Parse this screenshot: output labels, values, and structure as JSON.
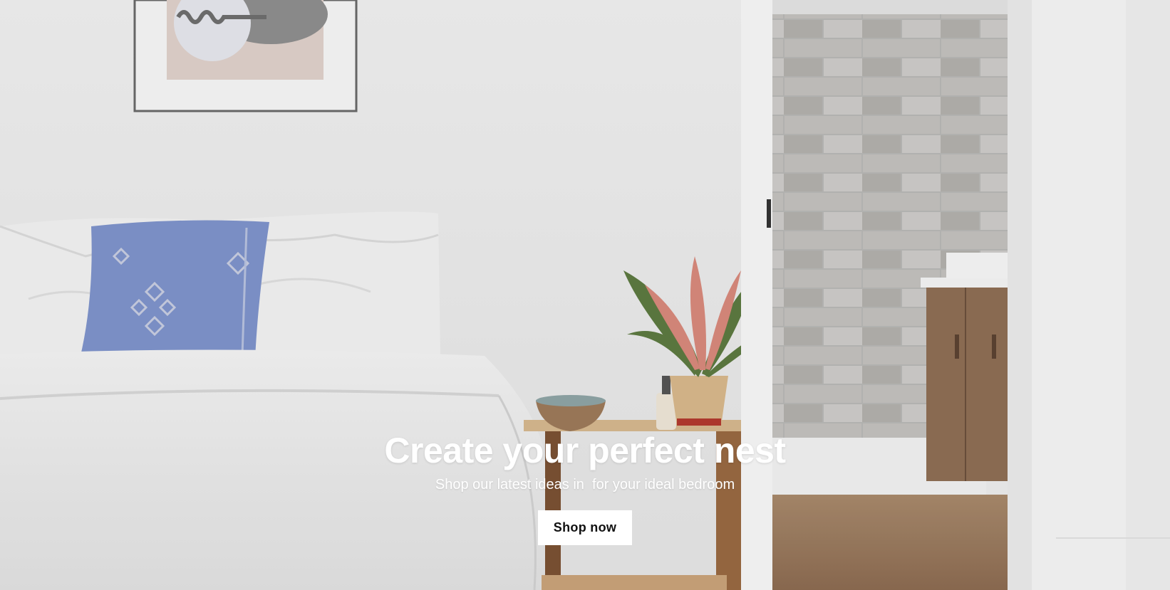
{
  "hero": {
    "title": "Create your perfect nest",
    "subtitle": "Shop our latest ideas in  for your ideal bedroom",
    "cta_label": "Shop now"
  },
  "colors": {
    "text_on_image": "#ffffff",
    "cta_background": "#ffffff",
    "cta_text": "#111111"
  },
  "icons": [
    "bedroom-photo"
  ]
}
